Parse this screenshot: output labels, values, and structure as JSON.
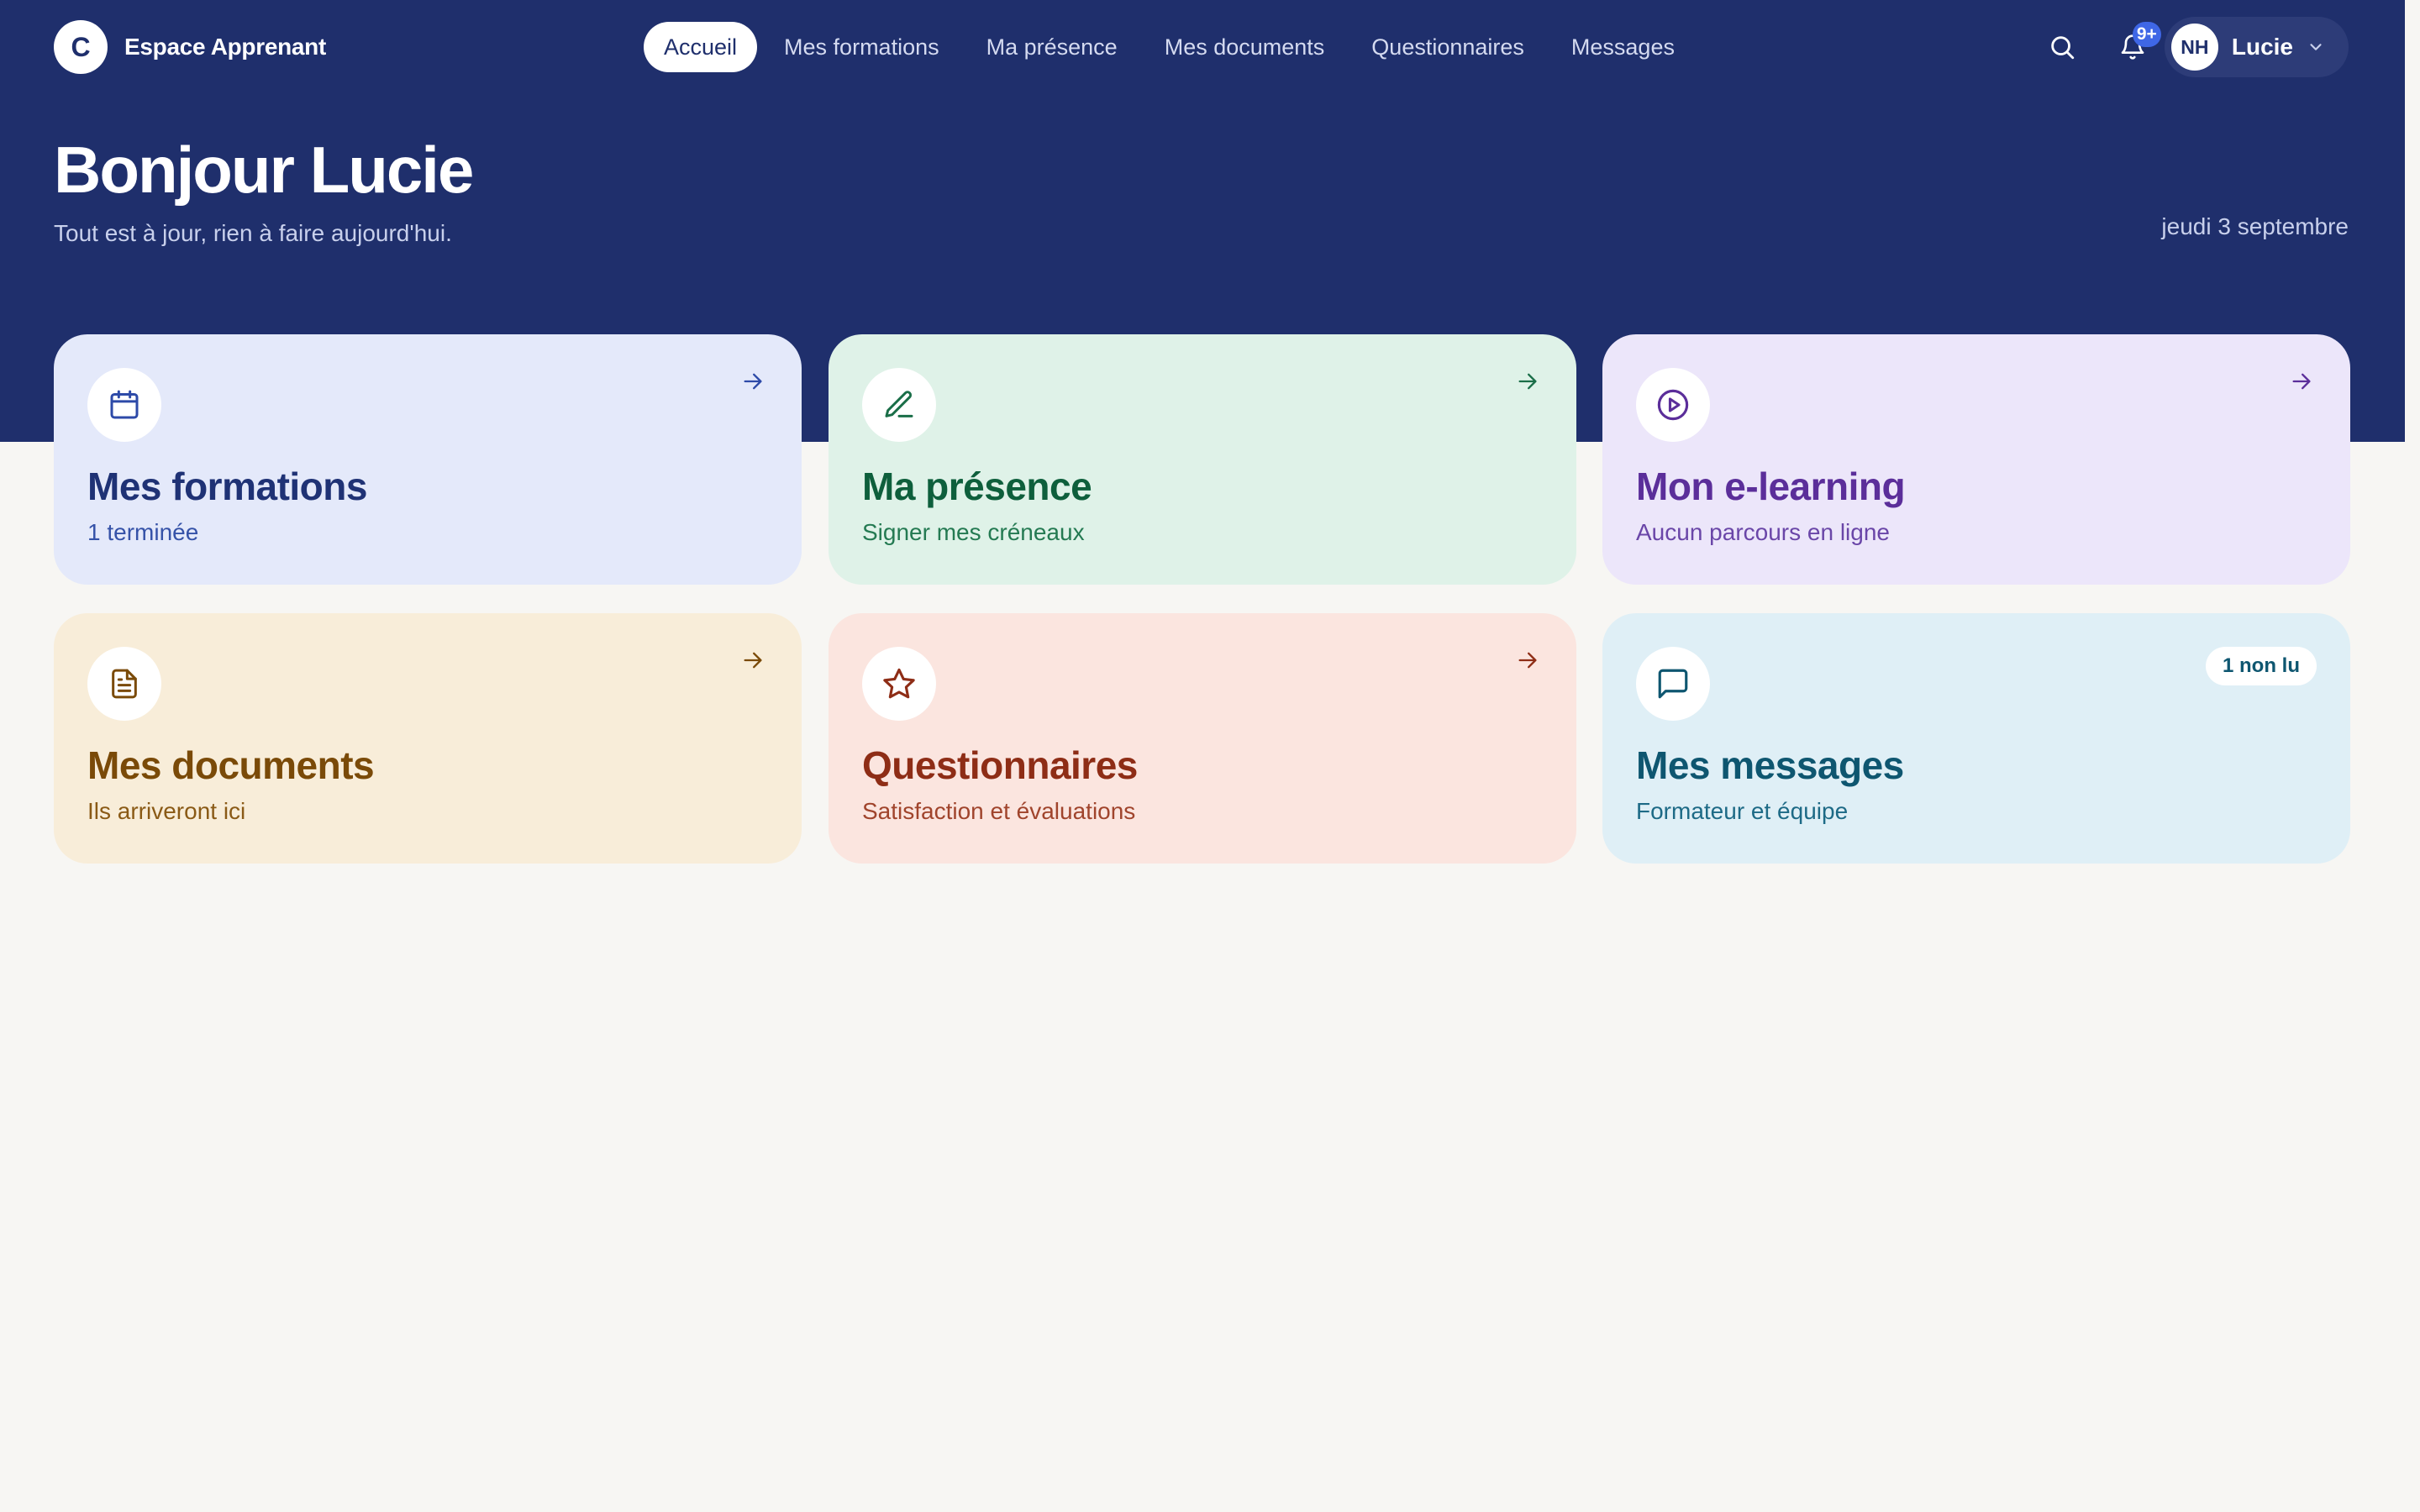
{
  "app": {
    "logo_letter": "C",
    "name": "Espace Apprenant"
  },
  "nav": {
    "items": [
      {
        "label": "Accueil",
        "active": true
      },
      {
        "label": "Mes formations",
        "active": false
      },
      {
        "label": "Ma présence",
        "active": false
      },
      {
        "label": "Mes documents",
        "active": false
      },
      {
        "label": "Questionnaires",
        "active": false
      },
      {
        "label": "Messages",
        "active": false
      }
    ]
  },
  "header_actions": {
    "search_icon": "search-icon",
    "bell_icon": "bell-icon",
    "notifications_badge": "9+",
    "user": {
      "initials": "NH",
      "name": "Lucie",
      "menu_icon": "chevron-down-icon"
    }
  },
  "hero": {
    "greeting": "Bonjour Lucie",
    "subtitle": "Tout est à jour, rien à faire aujourd'hui.",
    "date": "jeudi 3 septembre"
  },
  "cards": [
    {
      "title": "Mes formations",
      "subtitle": "1 terminée",
      "icon": "calendar-icon",
      "accent": "#1f3275",
      "background": "#e4e9fa"
    },
    {
      "title": "Ma présence",
      "subtitle": "Signer mes créneaux",
      "icon": "pen-icon",
      "accent": "#0e5f3c",
      "background": "#dff2e8"
    },
    {
      "title": "Mon e-learning",
      "subtitle": "Aucun parcours en ligne",
      "icon": "play-circle-icon",
      "accent": "#5b2e9a",
      "background": "#ece6fa"
    },
    {
      "title": "Mes documents",
      "subtitle": "Ils arriveront ici",
      "icon": "document-icon",
      "accent": "#7a4a08",
      "background": "#f8edd9"
    },
    {
      "title": "Questionnaires",
      "subtitle": "Satisfaction et évaluations",
      "icon": "star-icon",
      "accent": "#8e2d16",
      "background": "#fbe5df"
    },
    {
      "title": "Mes messages",
      "subtitle": "Formateur et équipe",
      "icon": "message-icon",
      "accent": "#0e5670",
      "background": "#dfeff6",
      "badge": "1 non lu"
    }
  ],
  "colors": {
    "hero_background": "#1f2f6c",
    "page_background": "#f7f6f3",
    "notification_badge": "#3f67e6"
  }
}
